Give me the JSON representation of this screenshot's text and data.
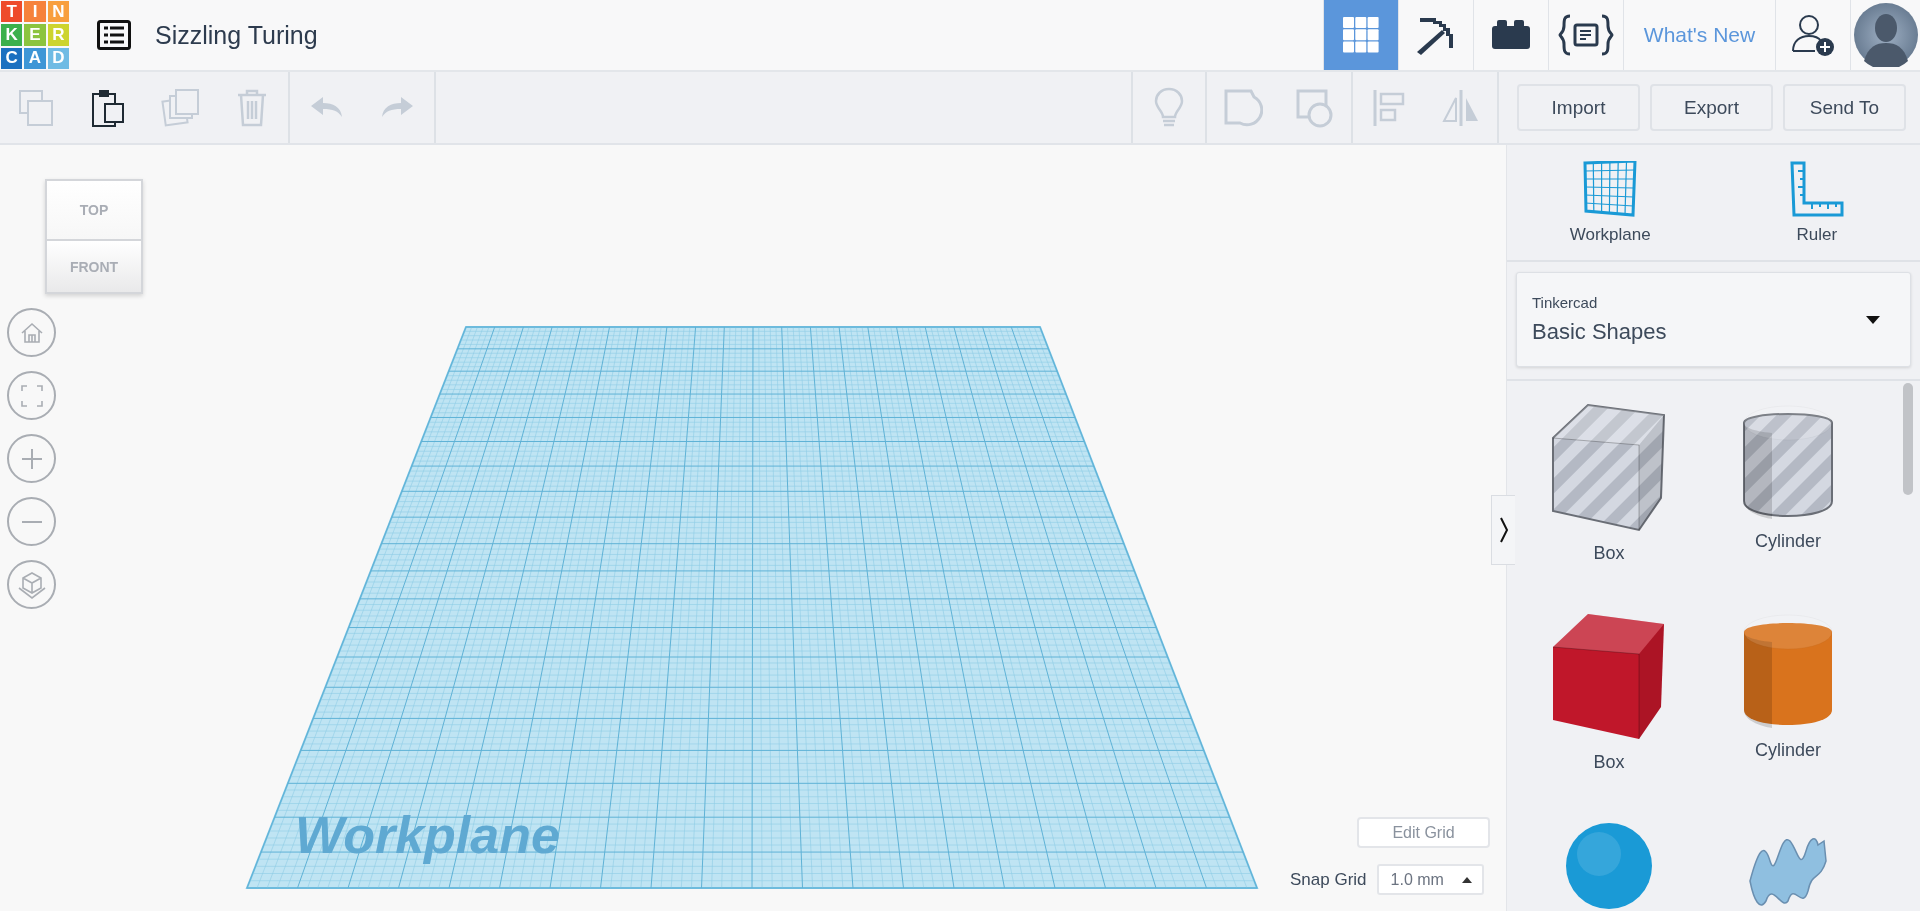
{
  "logo": {
    "tiles": [
      {
        "letter": "T",
        "color": "#ee4b2b"
      },
      {
        "letter": "I",
        "color": "#f6823c"
      },
      {
        "letter": "N",
        "color": "#f89f3e"
      },
      {
        "letter": "K",
        "color": "#3cb04c"
      },
      {
        "letter": "E",
        "color": "#8cc43f"
      },
      {
        "letter": "R",
        "color": "#cdd42f"
      },
      {
        "letter": "C",
        "color": "#1b70c0"
      },
      {
        "letter": "A",
        "color": "#3e96d6"
      },
      {
        "letter": "D",
        "color": "#6fbbe4"
      }
    ]
  },
  "design_title": "Sizzling Turing",
  "header_tabs": [
    {
      "kind": "grid-view",
      "selected": true
    },
    {
      "kind": "pickaxe",
      "selected": false
    },
    {
      "kind": "bricks",
      "selected": false
    },
    {
      "kind": "codeblocks",
      "selected": false
    },
    {
      "kind": "link",
      "label": "What's New",
      "selected": false
    }
  ],
  "toolbar": {
    "left": [
      [
        {
          "kind": "copy",
          "disabled": true
        },
        {
          "kind": "paste",
          "disabled": false
        },
        {
          "kind": "duplicate",
          "disabled": true
        },
        {
          "kind": "delete",
          "disabled": true
        }
      ],
      [
        {
          "kind": "undo",
          "disabled": true
        },
        {
          "kind": "redo",
          "disabled": true
        }
      ]
    ],
    "right": [
      [
        {
          "kind": "lightbulb",
          "disabled": true
        }
      ],
      [
        {
          "kind": "group",
          "disabled": true
        },
        {
          "kind": "ungroup",
          "disabled": true
        }
      ],
      [
        {
          "kind": "align",
          "disabled": true
        },
        {
          "kind": "mirror",
          "disabled": true
        }
      ]
    ],
    "buttons": [
      "Import",
      "Export",
      "Send To"
    ]
  },
  "view_cube": {
    "top": "TOP",
    "front": "FRONT"
  },
  "nav_buttons": [
    {
      "kind": "home"
    },
    {
      "kind": "fit"
    },
    {
      "kind": "zoom-in"
    },
    {
      "kind": "zoom-out"
    },
    {
      "kind": "ortho"
    }
  ],
  "workplane_label": "Workplane",
  "edit_grid": "Edit Grid",
  "snap_grid": {
    "label": "Snap Grid",
    "value": "1.0 mm"
  },
  "panel_tools": [
    {
      "kind": "workplane",
      "label": "Workplane"
    },
    {
      "kind": "ruler",
      "label": "Ruler"
    }
  ],
  "library": {
    "source": "Tinkercad",
    "name": "Basic Shapes"
  },
  "shapes": [
    {
      "kind": "box",
      "hole": true,
      "color": "#b4b9c4",
      "label": "Box"
    },
    {
      "kind": "cylinder",
      "hole": true,
      "color": "#b4b9c4",
      "label": "Cylinder"
    },
    {
      "kind": "box",
      "hole": false,
      "color": "#c0172a",
      "label": "Box"
    },
    {
      "kind": "cylinder",
      "hole": false,
      "color": "#d9731d",
      "label": "Cylinder"
    },
    {
      "kind": "sphere",
      "color": "#1a9ad6"
    },
    {
      "kind": "scribble",
      "color": "#8fbfe0"
    }
  ]
}
